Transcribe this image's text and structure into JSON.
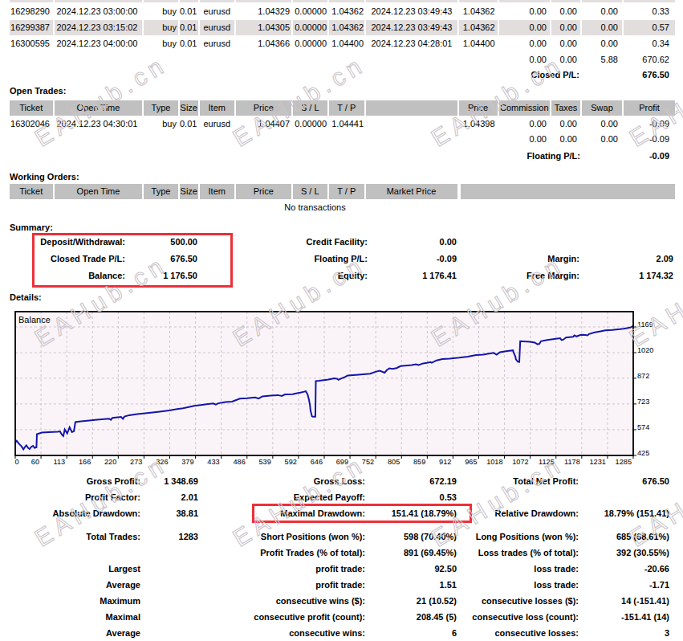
{
  "watermark": {
    "text": "EAHub.cn"
  },
  "closed_trades": {
    "rows": [
      {
        "ticket": "16298290",
        "open_time": "2024.12.23 03:00:00",
        "type": "buy",
        "size": "0.01",
        "item": "eurusd",
        "price": "1.04329",
        "sl": "0.00000",
        "tp": "1.04362",
        "close_time": "2024.12.23 03:49:43",
        "close_price": "1.04362",
        "commission": "0.00",
        "taxes": "0.00",
        "swap": "0.00",
        "profit": "0.33"
      },
      {
        "ticket": "16299387",
        "open_time": "2024.12.23 03:15:02",
        "type": "buy",
        "size": "0.01",
        "item": "eurusd",
        "price": "1.04305",
        "sl": "0.00000",
        "tp": "1.04362",
        "close_time": "2024.12.23 03:49:43",
        "close_price": "1.04362",
        "commission": "0.00",
        "taxes": "0.00",
        "swap": "0.00",
        "profit": "0.57"
      },
      {
        "ticket": "16300595",
        "open_time": "2024.12.23 04:00:00",
        "type": "buy",
        "size": "0.01",
        "item": "eurusd",
        "price": "1.04366",
        "sl": "0.00000",
        "tp": "1.04400",
        "close_time": "2024.12.23 04:28:01",
        "close_price": "1.04400",
        "commission": "0.00",
        "taxes": "0.00",
        "swap": "0.00",
        "profit": "0.34"
      }
    ],
    "totals": {
      "commission": "0.00",
      "taxes": "0.00",
      "swap": "5.88",
      "profit": "670.62"
    },
    "closed_pl": {
      "label": "Closed P/L:",
      "value": "676.50"
    }
  },
  "open_trades": {
    "heading": "Open Trades:",
    "columns": {
      "ticket": "Ticket",
      "open_time": "Open Time",
      "type": "Type",
      "size": "Size",
      "item": "Item",
      "price": "Price",
      "sl": "S / L",
      "tp": "T / P",
      "close_price": "Price",
      "commission": "Commission",
      "taxes": "Taxes",
      "swap": "Swap",
      "profit": "Profit"
    },
    "row": {
      "ticket": "16302046",
      "open_time": "2024.12.23 04:30:01",
      "type": "buy",
      "size": "0.01",
      "item": "eurusd",
      "price": "1.04407",
      "sl": "0.00000",
      "tp": "1.04441",
      "close_price": "1.04398",
      "commission": "0.00",
      "taxes": "0.00",
      "swap": "0.00",
      "profit": "-0.09"
    },
    "totals": {
      "commission": "0.00",
      "taxes": "0.00",
      "swap": "0.00",
      "profit": "-0.09"
    },
    "floating_pl": {
      "label": "Floating P/L:",
      "value": "-0.09"
    }
  },
  "working_orders": {
    "heading": "Working Orders:",
    "columns": {
      "ticket": "Ticket",
      "open_time": "Open Time",
      "type": "Type",
      "size": "Size",
      "item": "Item",
      "price": "Price",
      "sl": "S / L",
      "tp": "T / P",
      "market_price": "Market Price"
    },
    "empty_text": "No transactions"
  },
  "summary": {
    "heading": "Summary:",
    "deposit": {
      "label": "Deposit/Withdrawal:",
      "value": "500.00"
    },
    "credit": {
      "label": "Credit Facility:",
      "value": "0.00"
    },
    "closed_pl": {
      "label": "Closed Trade P/L:",
      "value": "676.50"
    },
    "floating_pl": {
      "label": "Floating P/L:",
      "value": "-0.09"
    },
    "margin": {
      "label": "Margin:",
      "value": "2.09"
    },
    "balance": {
      "label": "Balance:",
      "value": "1 176.50"
    },
    "equity": {
      "label": "Equity:",
      "value": "1 176.41"
    },
    "free_margin": {
      "label": "Free Margin:",
      "value": "1 174.32"
    }
  },
  "details": {
    "heading": "Details:"
  },
  "chart_data": {
    "type": "line",
    "title": "Balance",
    "series_label": "Balance",
    "xlabel": "",
    "ylabel": "",
    "x_tick_labels": [
      "0",
      "60",
      "113",
      "166",
      "220",
      "273",
      "326",
      "379",
      "433",
      "486",
      "539",
      "592",
      "646",
      "699",
      "752",
      "805",
      "859",
      "912",
      "965",
      "1018",
      "1072",
      "1125",
      "1178",
      "1231",
      "1285"
    ],
    "y_tick_labels": [
      "1169",
      "1020",
      "872",
      "723",
      "574",
      "425"
    ],
    "xlim": [
      0,
      1285
    ],
    "ylim": [
      425,
      1248
    ],
    "grid": true,
    "legend_position": "top-left",
    "line_color": "#1414AA",
    "plot_background": "#FAF4F8",
    "grid_color": "#CDC5CB",
    "points": [
      [
        0,
        500
      ],
      [
        3,
        509
      ],
      [
        8,
        492
      ],
      [
        13,
        478
      ],
      [
        17,
        461
      ],
      [
        20,
        474
      ],
      [
        23,
        484
      ],
      [
        27,
        468
      ],
      [
        30,
        462
      ],
      [
        33,
        474
      ],
      [
        37,
        481
      ],
      [
        40,
        469
      ],
      [
        44,
        472
      ],
      [
        45,
        548
      ],
      [
        55,
        557
      ],
      [
        70,
        560
      ],
      [
        88,
        562
      ],
      [
        93,
        564
      ],
      [
        97,
        545
      ],
      [
        100,
        537
      ],
      [
        103,
        575
      ],
      [
        108,
        553
      ],
      [
        113,
        588
      ],
      [
        118,
        560
      ],
      [
        122,
        565
      ],
      [
        125,
        618
      ],
      [
        137,
        622
      ],
      [
        154,
        627
      ],
      [
        170,
        632
      ],
      [
        195,
        638
      ],
      [
        199,
        631
      ],
      [
        202,
        642
      ],
      [
        220,
        648
      ],
      [
        224,
        637
      ],
      [
        227,
        650
      ],
      [
        237,
        658
      ],
      [
        254,
        664
      ],
      [
        274,
        670
      ],
      [
        297,
        677
      ],
      [
        320,
        685
      ],
      [
        334,
        692
      ],
      [
        349,
        698
      ],
      [
        372,
        712
      ],
      [
        397,
        721
      ],
      [
        412,
        726
      ],
      [
        417,
        720
      ],
      [
        422,
        727
      ],
      [
        437,
        734
      ],
      [
        451,
        737
      ],
      [
        467,
        754
      ],
      [
        482,
        756
      ],
      [
        499,
        761
      ],
      [
        506,
        754
      ],
      [
        514,
        767
      ],
      [
        531,
        771
      ],
      [
        546,
        774
      ],
      [
        554,
        769
      ],
      [
        561,
        778
      ],
      [
        577,
        780
      ],
      [
        584,
        784
      ],
      [
        593,
        789
      ],
      [
        601,
        794
      ],
      [
        604,
        797
      ],
      [
        608,
        778
      ],
      [
        611,
        745
      ],
      [
        613,
        712
      ],
      [
        614,
        685
      ],
      [
        616,
        663
      ],
      [
        617,
        652
      ],
      [
        619,
        649
      ],
      [
        624,
        649
      ],
      [
        625,
        855
      ],
      [
        632,
        857
      ],
      [
        651,
        864
      ],
      [
        663,
        871
      ],
      [
        669,
        869
      ],
      [
        672,
        863
      ],
      [
        677,
        870
      ],
      [
        684,
        877
      ],
      [
        691,
        887
      ],
      [
        714,
        893
      ],
      [
        738,
        898
      ],
      [
        749,
        909
      ],
      [
        758,
        915
      ],
      [
        768,
        904
      ],
      [
        773,
        920
      ],
      [
        778,
        929
      ],
      [
        784,
        926
      ],
      [
        793,
        931
      ],
      [
        801,
        942
      ],
      [
        824,
        948
      ],
      [
        833,
        953
      ],
      [
        839,
        948
      ],
      [
        848,
        958
      ],
      [
        856,
        961
      ],
      [
        863,
        966
      ],
      [
        866,
        961
      ],
      [
        876,
        975
      ],
      [
        888,
        983
      ],
      [
        903,
        986
      ],
      [
        923,
        991
      ],
      [
        941,
        997
      ],
      [
        958,
        1006
      ],
      [
        973,
        1008
      ],
      [
        990,
        1017
      ],
      [
        995,
        1019
      ],
      [
        1001,
        1008
      ],
      [
        1008,
        1023
      ],
      [
        1023,
        1030
      ],
      [
        1035,
        1033
      ],
      [
        1036,
        1023
      ],
      [
        1040,
        997
      ],
      [
        1041,
        981
      ],
      [
        1045,
        967
      ],
      [
        1048,
        966
      ],
      [
        1050,
        1086
      ],
      [
        1070,
        1083
      ],
      [
        1080,
        1079
      ],
      [
        1086,
        1068
      ],
      [
        1090,
        1072
      ],
      [
        1093,
        1086
      ],
      [
        1106,
        1093
      ],
      [
        1121,
        1099
      ],
      [
        1133,
        1104
      ],
      [
        1136,
        1093
      ],
      [
        1140,
        1096
      ],
      [
        1145,
        1107
      ],
      [
        1160,
        1112
      ],
      [
        1163,
        1120
      ],
      [
        1167,
        1114
      ],
      [
        1175,
        1122
      ],
      [
        1182,
        1124
      ],
      [
        1190,
        1120
      ],
      [
        1193,
        1128
      ],
      [
        1205,
        1138
      ],
      [
        1217,
        1144
      ],
      [
        1227,
        1149
      ],
      [
        1242,
        1152
      ],
      [
        1257,
        1156
      ],
      [
        1265,
        1159
      ],
      [
        1272,
        1162
      ],
      [
        1280,
        1166
      ],
      [
        1285,
        1176
      ]
    ]
  },
  "stats": {
    "rows": [
      {
        "l1": "Gross Profit:",
        "v1": "1 348.69",
        "l2": "Gross Loss:",
        "v2": "672.19",
        "l3": "Total Net Profit:",
        "v3": "676.50"
      },
      {
        "l1": "Profit Factor:",
        "v1": "2.01",
        "l2": "Expected Payoff:",
        "v2": "0.53",
        "l3": "",
        "v3": ""
      },
      {
        "l1": "Absolute Drawdown:",
        "v1": "38.81",
        "l2": "Maximal Drawdown:",
        "v2": "151.41 (18.79%)",
        "l3": "Relative Drawdown:",
        "v3": "18.79% (151.41)"
      },
      {
        "l1": "Total Trades:",
        "v1": "1283",
        "l2": "Short Positions (won %):",
        "v2": "598 (70.40%)",
        "l3": "Long Positions (won %):",
        "v3": "685 (68.61%)"
      },
      {
        "l1": "",
        "v1": "",
        "l2": "Profit Trades (% of total):",
        "v2": "891 (69.45%)",
        "l3": "Loss trades (% of total):",
        "v3": "392 (30.55%)"
      },
      {
        "l1": "Largest",
        "v1": "",
        "l2": "profit trade:",
        "v2": "92.50",
        "l3": "loss trade:",
        "v3": "-20.66"
      },
      {
        "l1": "Average",
        "v1": "",
        "l2": "profit trade:",
        "v2": "1.51",
        "l3": "loss trade:",
        "v3": "-1.71"
      },
      {
        "l1": "Maximum",
        "v1": "",
        "l2": "consecutive wins ($):",
        "v2": "21 (10.52)",
        "l3": "consecutive losses ($):",
        "v3": "14 (-151.41)"
      },
      {
        "l1": "Maximal",
        "v1": "",
        "l2": "consecutive profit (count):",
        "v2": "208.45 (5)",
        "l3": "consecutive loss (count):",
        "v3": "-151.41 (14)"
      },
      {
        "l1": "Average",
        "v1": "",
        "l2": "consecutive wins:",
        "v2": "6",
        "l3": "consecutive losses:",
        "v3": "3"
      }
    ]
  },
  "annotations": {
    "highlight_color": "#EE2F38"
  }
}
